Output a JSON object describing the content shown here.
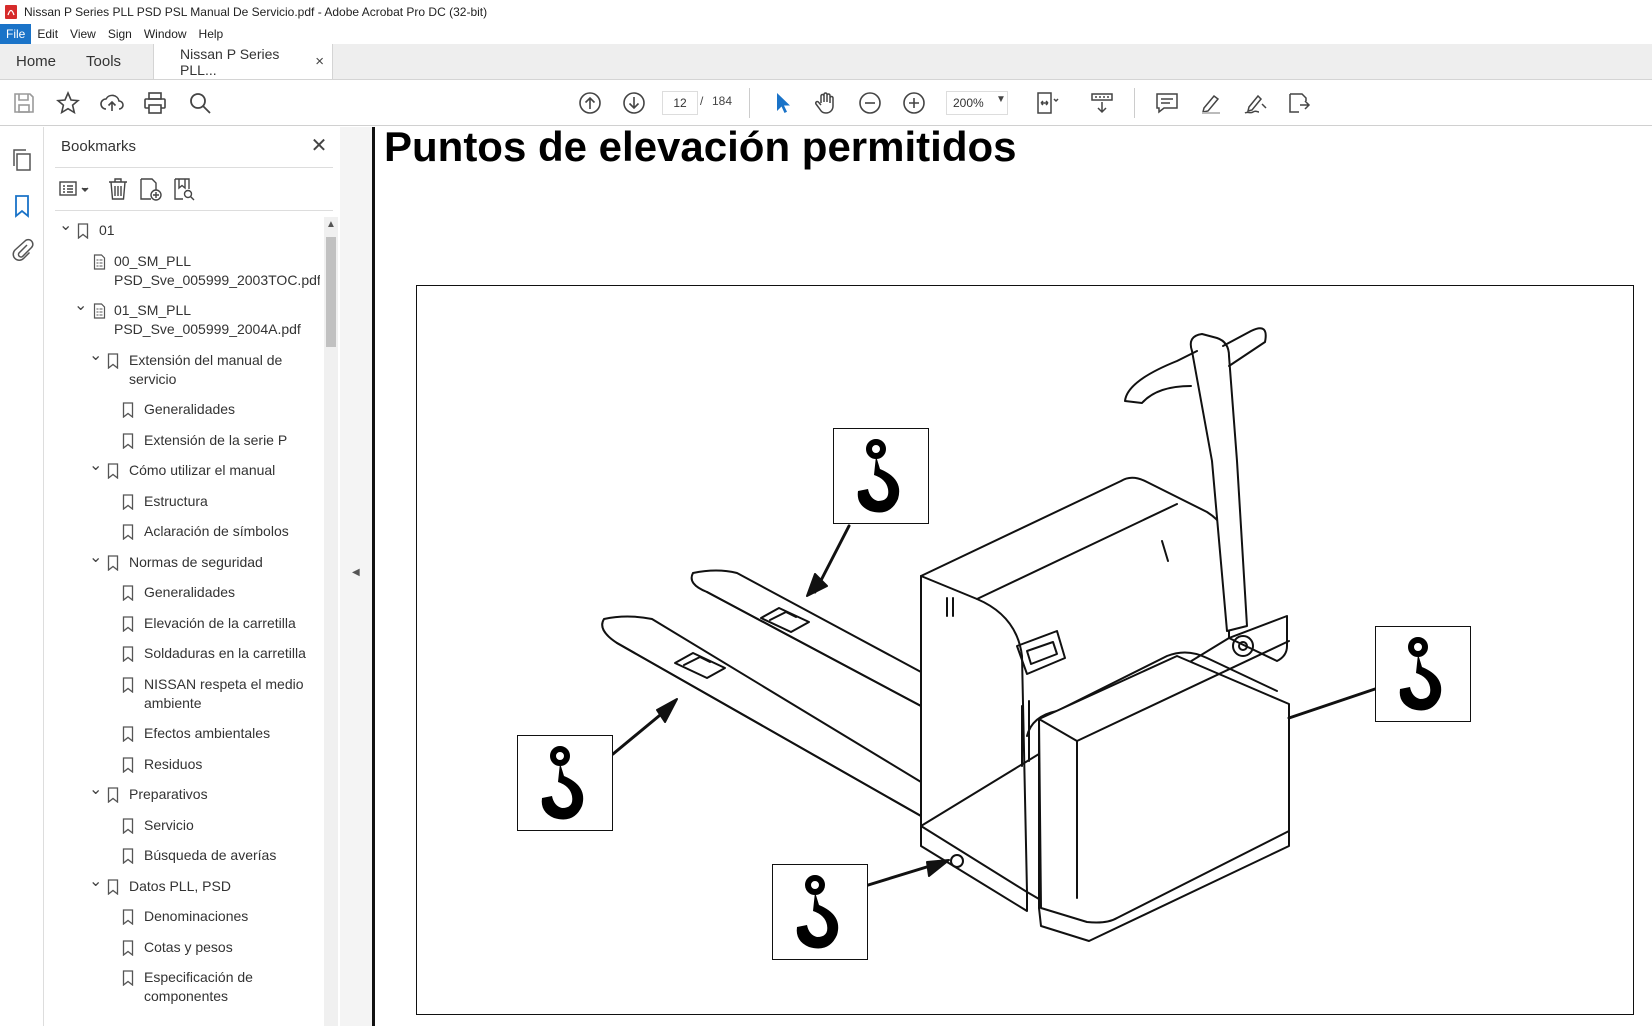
{
  "window": {
    "title": "Nissan P Series PLL PSD PSL Manual De Servicio.pdf - Adobe Acrobat Pro DC (32-bit)"
  },
  "menu": [
    "File",
    "Edit",
    "View",
    "Sign",
    "Window",
    "Help"
  ],
  "tabs": {
    "home": "Home",
    "tools": "Tools",
    "document": "Nissan P Series PLL...",
    "close": "×"
  },
  "toolbar": {
    "page_current": "12",
    "page_sep": "/",
    "page_total": "184",
    "zoom": "200%",
    "icons": [
      "save-icon",
      "star-icon",
      "upload-icon",
      "print-icon",
      "search-zoom-icon",
      "page-up-icon",
      "page-down-icon",
      "select-cursor-icon",
      "hand-icon",
      "zoom-out-icon",
      "zoom-in-icon",
      "fit-page-icon",
      "scroll-mode-icon",
      "comment-icon",
      "highlight-icon",
      "sign-icon",
      "share-icon"
    ]
  },
  "bookmarks_panel": {
    "title": "Bookmarks",
    "close": "✕",
    "items": [
      {
        "label": "01",
        "level": 0,
        "expanded": true,
        "kind": "bookmark"
      },
      {
        "label": "00_SM_PLL\nPSD_Sve_005999_2003TOC.pdf",
        "level": 1,
        "expanded": null,
        "kind": "file"
      },
      {
        "label": "01_SM_PLL\nPSD_Sve_005999_2004A.pdf",
        "level": 1,
        "expanded": true,
        "kind": "file"
      },
      {
        "label": "Extensión del manual de\nservicio",
        "level": 2,
        "expanded": true,
        "kind": "bookmark"
      },
      {
        "label": "Generalidades",
        "level": 3,
        "expanded": null,
        "kind": "bookmark"
      },
      {
        "label": "Extensión de la serie P",
        "level": 3,
        "expanded": null,
        "kind": "bookmark"
      },
      {
        "label": "Cómo utilizar el manual",
        "level": 2,
        "expanded": true,
        "kind": "bookmark"
      },
      {
        "label": "Estructura",
        "level": 3,
        "expanded": null,
        "kind": "bookmark"
      },
      {
        "label": "Aclaración de símbolos",
        "level": 3,
        "expanded": null,
        "kind": "bookmark"
      },
      {
        "label": "Normas de seguridad",
        "level": 2,
        "expanded": true,
        "kind": "bookmark"
      },
      {
        "label": "Generalidades",
        "level": 3,
        "expanded": null,
        "kind": "bookmark"
      },
      {
        "label": "Elevación de la carretilla",
        "level": 3,
        "expanded": null,
        "kind": "bookmark"
      },
      {
        "label": "Soldaduras en la carretilla",
        "level": 3,
        "expanded": null,
        "kind": "bookmark"
      },
      {
        "label": "NISSAN respeta el medio\nambiente",
        "level": 3,
        "expanded": null,
        "kind": "bookmark"
      },
      {
        "label": "Efectos ambientales",
        "level": 3,
        "expanded": null,
        "kind": "bookmark"
      },
      {
        "label": "Residuos",
        "level": 3,
        "expanded": null,
        "kind": "bookmark"
      },
      {
        "label": "Preparativos",
        "level": 2,
        "expanded": true,
        "kind": "bookmark"
      },
      {
        "label": "Servicio",
        "level": 3,
        "expanded": null,
        "kind": "bookmark"
      },
      {
        "label": "Búsqueda de averías",
        "level": 3,
        "expanded": null,
        "kind": "bookmark"
      },
      {
        "label": "Datos PLL, PSD",
        "level": 2,
        "expanded": true,
        "kind": "bookmark"
      },
      {
        "label": "Denominaciones",
        "level": 3,
        "expanded": null,
        "kind": "bookmark"
      },
      {
        "label": "Cotas y pesos",
        "level": 3,
        "expanded": null,
        "kind": "bookmark"
      },
      {
        "label": "Especificación de\ncomponentes",
        "level": 3,
        "expanded": null,
        "kind": "bookmark"
      }
    ]
  },
  "document": {
    "heading": "Puntos de elevación permitidos",
    "illustration": "pallet-truck-lifting-points"
  }
}
